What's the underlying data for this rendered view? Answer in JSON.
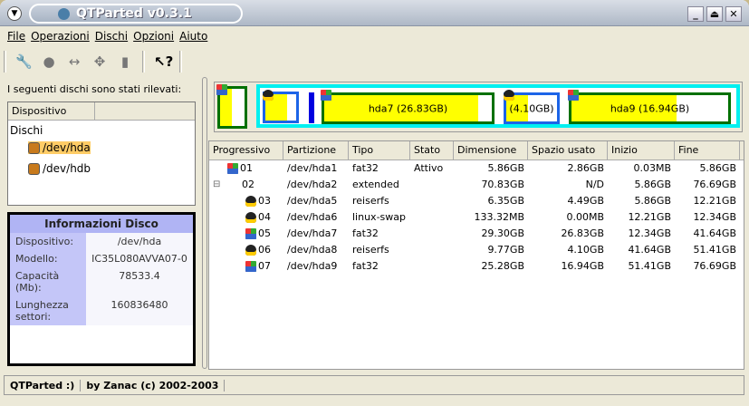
{
  "window": {
    "title": "QTParted v0.3.1"
  },
  "menu": [
    "File",
    "Operazioni",
    "Dischi",
    "Opzioni",
    "Aiuto"
  ],
  "toolbar": [
    "wrench-icon",
    "bomb-icon",
    "resize-icon",
    "move-icon",
    "trash-icon",
    "whats-this-icon"
  ],
  "left": {
    "detected_label": "I seguenti dischi sono stati rilevati:",
    "tree_header": "Dispositivo",
    "tree_root": "Dischi",
    "disks": [
      "/dev/hda",
      "/dev/hdb"
    ]
  },
  "info": {
    "title": "Informazioni Disco",
    "rows": [
      {
        "k": "Dispositivo:",
        "v": "/dev/hda"
      },
      {
        "k": "Modello:",
        "v": "IC35L080AVVA07-0"
      },
      {
        "k": "Capacità (Mb):",
        "v": "78533.4"
      },
      {
        "k": "Lunghezza settori:",
        "v": "160836480"
      }
    ]
  },
  "map": {
    "hda7_label": "hda7 (26.83GB)",
    "hda8_label": "(4.10GB)",
    "hda9_label": "hda9 (16.94GB)",
    "usage": {
      "hda1": 0.49,
      "hda5": 0.71,
      "hda7": 0.92,
      "hda8": 0.42,
      "hda9": 0.67
    },
    "colors": {
      "fat32": "#007000",
      "reiserfs": "#1c64e8",
      "swap": "#0000e0",
      "extended": "#00f0f0",
      "used": "#ffff00"
    }
  },
  "table": {
    "headers": [
      "Progressivo",
      "Partizione",
      "Tipo",
      "Stato",
      "Dimensione",
      "Spazio usato",
      "Inizio",
      "Fine"
    ],
    "rows": [
      [
        "01",
        "/dev/hda1",
        "fat32",
        "Attivo",
        "5.86GB",
        "2.86GB",
        "0.03MB",
        "5.86GB"
      ],
      [
        "02",
        "/dev/hda2",
        "extended",
        "",
        "70.83GB",
        "N/D",
        "5.86GB",
        "76.69GB"
      ],
      [
        "03",
        "/dev/hda5",
        "reiserfs",
        "",
        "6.35GB",
        "4.49GB",
        "5.86GB",
        "12.21GB"
      ],
      [
        "04",
        "/dev/hda6",
        "linux-swap",
        "",
        "133.32MB",
        "0.00MB",
        "12.21GB",
        "12.34GB"
      ],
      [
        "05",
        "/dev/hda7",
        "fat32",
        "",
        "29.30GB",
        "26.83GB",
        "12.34GB",
        "41.64GB"
      ],
      [
        "06",
        "/dev/hda8",
        "reiserfs",
        "",
        "9.77GB",
        "4.10GB",
        "41.64GB",
        "51.41GB"
      ],
      [
        "07",
        "/dev/hda9",
        "fat32",
        "",
        "25.28GB",
        "16.94GB",
        "51.41GB",
        "76.69GB"
      ]
    ]
  },
  "status": {
    "left": "QTParted :)",
    "right": "by Zanac (c) 2002-2003"
  }
}
